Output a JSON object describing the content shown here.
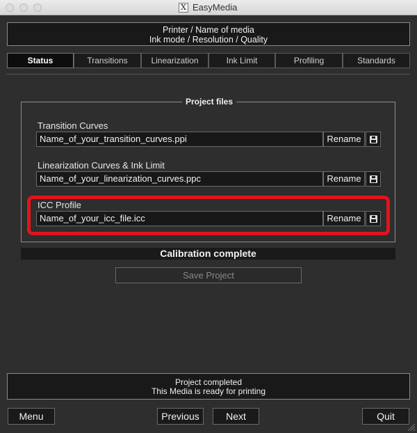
{
  "window": {
    "title": "EasyMedia",
    "app_icon": "X"
  },
  "header": {
    "line1": "Printer / Name of media",
    "line2": "Ink mode / Resolution / Quality"
  },
  "tabs": [
    {
      "label": "Status",
      "active": true
    },
    {
      "label": "Transitions",
      "active": false
    },
    {
      "label": "Linearization",
      "active": false
    },
    {
      "label": "Ink Limit",
      "active": false
    },
    {
      "label": "Profiling",
      "active": false
    },
    {
      "label": "Standards",
      "active": false
    }
  ],
  "project_files": {
    "title": "Project files",
    "rename_label": "Rename",
    "save_icon": "floppy-disk-icon",
    "files": [
      {
        "label": "Transition Curves",
        "value": "Name_of_your_transition_curves.ppi"
      },
      {
        "label": "Linearization Curves & Ink Limit",
        "value": "Name_of_your_linearization_curves.ppc"
      },
      {
        "label": "ICC Profile",
        "value": "Name_of_your_icc_file.icc"
      }
    ],
    "highlight_color": "#e0141b"
  },
  "calibration_status": "Calibration complete",
  "save_project_label": "Save Project",
  "footer_status": {
    "line1": "Project completed",
    "line2": "This Media is ready for printing"
  },
  "buttons": {
    "menu": "Menu",
    "previous": "Previous",
    "next": "Next",
    "quit": "Quit"
  }
}
